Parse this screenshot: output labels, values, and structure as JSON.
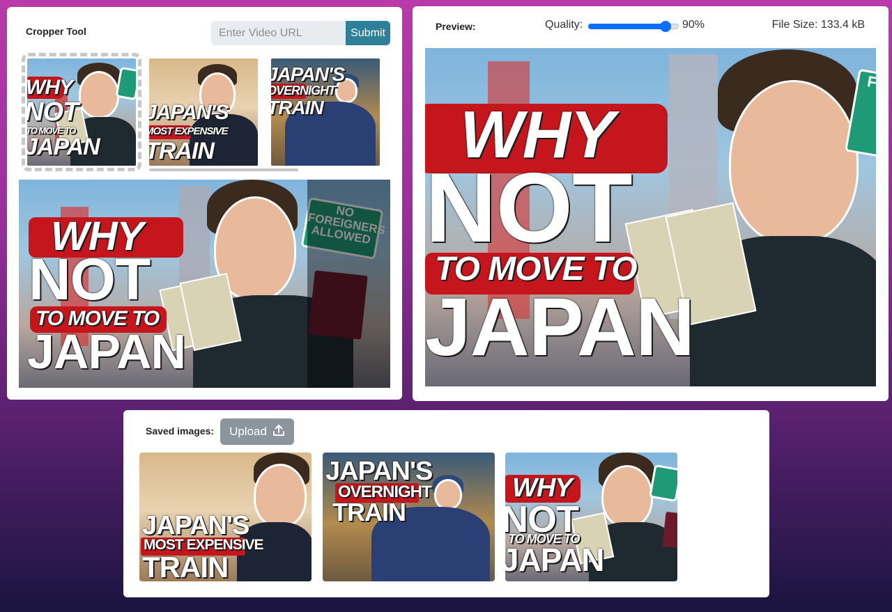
{
  "cropper": {
    "title": "Cropper Tool",
    "url_placeholder": "Enter Video URL",
    "submit_label": "Submit",
    "thumbnails": [
      {
        "line1": "WHY",
        "line2": "NOT",
        "line3": "TO MOVE TO",
        "line4": "JAPAN",
        "selected": true
      },
      {
        "line1": "JAPAN'S",
        "line2": "MOST EXPENSIVE",
        "line3": "TRAIN",
        "selected": false
      },
      {
        "line1": "JAPAN'S",
        "line2": "OVERNIGHT",
        "line3": "TRAIN",
        "selected": false
      }
    ],
    "crop_text": {
      "l1": "WHY",
      "l2": "NOT",
      "l3": "TO MOVE TO",
      "l4": "JAPAN",
      "sign": "NO FOREIGNERS ALLOWED"
    }
  },
  "preview": {
    "label": "Preview:",
    "quality_label": "Quality:",
    "quality_value": "90%",
    "quality_level": 0.9,
    "file_size": "File Size: 133.4 kB",
    "image_text": {
      "l1": "WHY",
      "l2": "NOT",
      "l3": "TO MOVE TO",
      "l4": "JAPAN",
      "sign": "FO"
    }
  },
  "saved": {
    "label": "Saved images:",
    "upload_label": "Upload",
    "items": [
      {
        "l1": "JAPAN'S",
        "l2": "MOST EXPENSIVE",
        "l3": "TRAIN"
      },
      {
        "l1": "JAPAN'S",
        "l2": "OVERNIGHT",
        "l3": "TRAIN"
      },
      {
        "l1": "WHY",
        "l2": "NOT",
        "l3": "TO MOVE TO",
        "l4": "JAPAN"
      }
    ]
  },
  "colors": {
    "accent": "#0d6efd",
    "submit": "#2e7f98",
    "upload": "#8c959e",
    "thumb_red": "#c4161c",
    "sign_green": "#1f9a76"
  },
  "icons": {
    "upload": "upload-icon"
  }
}
